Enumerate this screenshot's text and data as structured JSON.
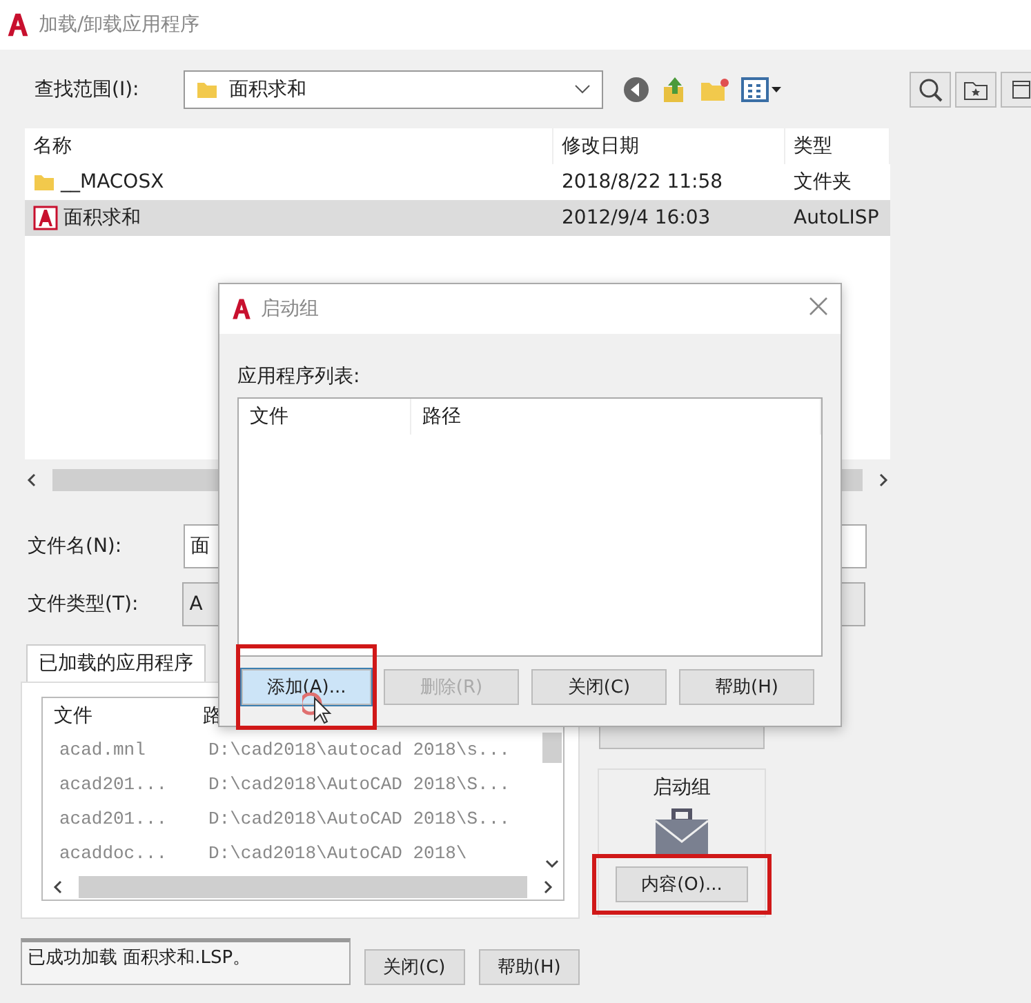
{
  "window": {
    "title": "加载/卸载应用程序"
  },
  "look_in": {
    "label": "查找范围(I):",
    "value": "面积求和"
  },
  "file_list": {
    "columns": [
      "名称",
      "修改日期",
      "类型"
    ],
    "rows": [
      {
        "name": "__MACOSX",
        "kind": "folder",
        "date": "2018/8/22 11:58",
        "type": "文件夹",
        "selected": false
      },
      {
        "name": "面积求和",
        "kind": "lisp",
        "date": "2012/9/4 16:03",
        "type": "AutoLISP",
        "selected": true
      }
    ]
  },
  "file_name": {
    "label": "文件名(N):",
    "value": "面"
  },
  "file_type": {
    "label": "文件类型(T):",
    "value": "A"
  },
  "loaded_tab": {
    "label": "已加载的应用程序",
    "selected": true
  },
  "loaded_list": {
    "columns": [
      "文件",
      "路"
    ],
    "rows": [
      {
        "file": "acad.mnl",
        "path": "D:\\cad2018\\autocad 2018\\s..."
      },
      {
        "file": "acad201...",
        "path": "D:\\cad2018\\AutoCAD 2018\\S..."
      },
      {
        "file": "acad201...",
        "path": "D:\\cad2018\\AutoCAD 2018\\S..."
      },
      {
        "file": "acaddoc...",
        "path": "D:\\cad2018\\AutoCAD 2018\\"
      }
    ]
  },
  "startup_group": {
    "label": "启动组",
    "button": "内容(O)...",
    "highlighted": true
  },
  "status": "已成功加载 面积求和.LSP。",
  "buttons": [
    {
      "label": "关闭(C)"
    },
    {
      "label": "帮助(H)"
    }
  ],
  "dialog": {
    "title": "启动组",
    "list_label": "应用程序列表:",
    "columns": [
      "文件",
      "路径"
    ],
    "buttons": [
      {
        "label": "添加(A)...",
        "disabled": false,
        "highlighted": true
      },
      {
        "label": "删除(R)",
        "disabled": true,
        "highlighted": false
      },
      {
        "label": "关闭(C)",
        "disabled": false,
        "highlighted": false
      },
      {
        "label": "帮助(H)",
        "disabled": false,
        "highlighted": false
      }
    ]
  }
}
